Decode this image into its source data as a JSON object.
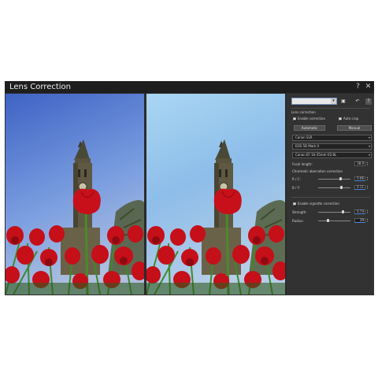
{
  "window": {
    "title": "Lens Correction"
  },
  "titlebar": {
    "help_icon": "question-icon",
    "close_icon": "close-icon"
  },
  "panel": {
    "preset_value": "",
    "icons": [
      "save-icon",
      "reset-icon",
      "help-icon"
    ],
    "lens_section": "Lens correction",
    "enable_correction": {
      "label": "Enable correction",
      "checked": true
    },
    "auto_crop": {
      "label": "Auto crop",
      "checked": true
    },
    "tabs": {
      "automatic": "Automatic",
      "manual": "Manual"
    },
    "camera_make": "Canon SLR",
    "camera_model": "EOS 5D Mark II",
    "lens_model": "Canon EF 16-35mm f/2.8L",
    "focal_length": {
      "label": "Focal length:",
      "value": "28.0"
    },
    "chromatic_section": "Chromatic aberration correction",
    "rc": {
      "label": "R / C:",
      "value": "0.06",
      "level": 0.7
    },
    "by": {
      "label": "B / Y:",
      "value": "0.11",
      "level": 0.72
    },
    "vignette": {
      "label": "Enable vignette correction",
      "checked": true
    },
    "strength": {
      "label": "Strength:",
      "value": "0.74",
      "level": 0.78
    },
    "radius": {
      "label": "Radius:",
      "value": "39",
      "level": 0.3
    }
  },
  "colors": {
    "sky": "#5a7ed8",
    "petal": "#c8101a",
    "panel_bg": "#323232",
    "accent": "#4a8ee8"
  }
}
